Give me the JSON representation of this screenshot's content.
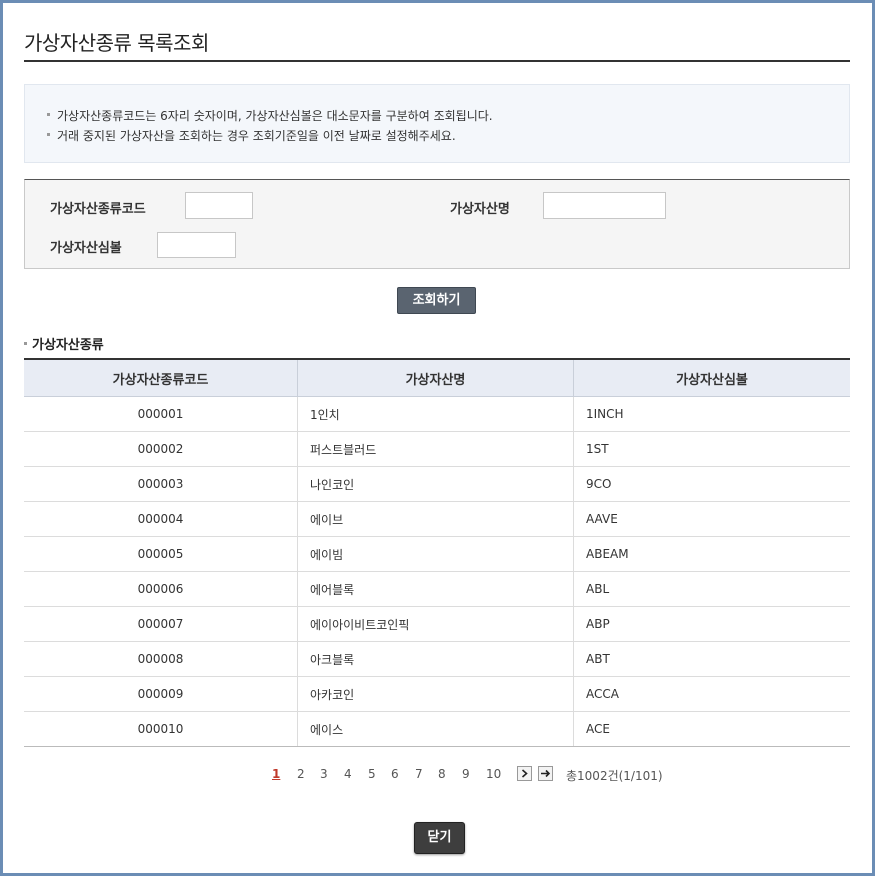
{
  "page": {
    "title": "가상자산종류 목록조회",
    "notices": [
      "가상자산종류코드는 6자리 숫자이며, 가상자산심볼은 대소문자를 구분하여 조회됩니다.",
      "거래 중지된 가상자산을 조회하는 경우 조회기준일을 이전 날짜로 설정해주세요."
    ]
  },
  "search": {
    "code_label": "가상자산종류코드",
    "code_value": "",
    "name_label": "가상자산명",
    "name_value": "",
    "symbol_label": "가상자산심볼",
    "symbol_value": "",
    "submit_label": "조회하기"
  },
  "list": {
    "section_title": "가상자산종류",
    "columns": [
      "가상자산종류코드",
      "가상자산명",
      "가상자산심볼"
    ],
    "rows": [
      {
        "code": "000001",
        "name": "1인치",
        "symbol": "1INCH"
      },
      {
        "code": "000002",
        "name": "퍼스트블러드",
        "symbol": "1ST"
      },
      {
        "code": "000003",
        "name": "나인코인",
        "symbol": "9CO"
      },
      {
        "code": "000004",
        "name": "에이브",
        "symbol": "AAVE"
      },
      {
        "code": "000005",
        "name": "에이빔",
        "symbol": "ABEAM"
      },
      {
        "code": "000006",
        "name": "에어블록",
        "symbol": "ABL"
      },
      {
        "code": "000007",
        "name": "에이아이비트코인픽",
        "symbol": "ABP"
      },
      {
        "code": "000008",
        "name": "아크블록",
        "symbol": "ABT"
      },
      {
        "code": "000009",
        "name": "아카코인",
        "symbol": "ACCA"
      },
      {
        "code": "000010",
        "name": "에이스",
        "symbol": "ACE"
      }
    ]
  },
  "pagination": {
    "pages": [
      "1",
      "2",
      "3",
      "4",
      "5",
      "6",
      "7",
      "8",
      "9",
      "10"
    ],
    "current": "1",
    "next_icon": "chevron-right-icon",
    "last_icon": "arrow-right-icon",
    "total_text": "총1002건(1/101)"
  },
  "footer": {
    "close_label": "닫기"
  }
}
